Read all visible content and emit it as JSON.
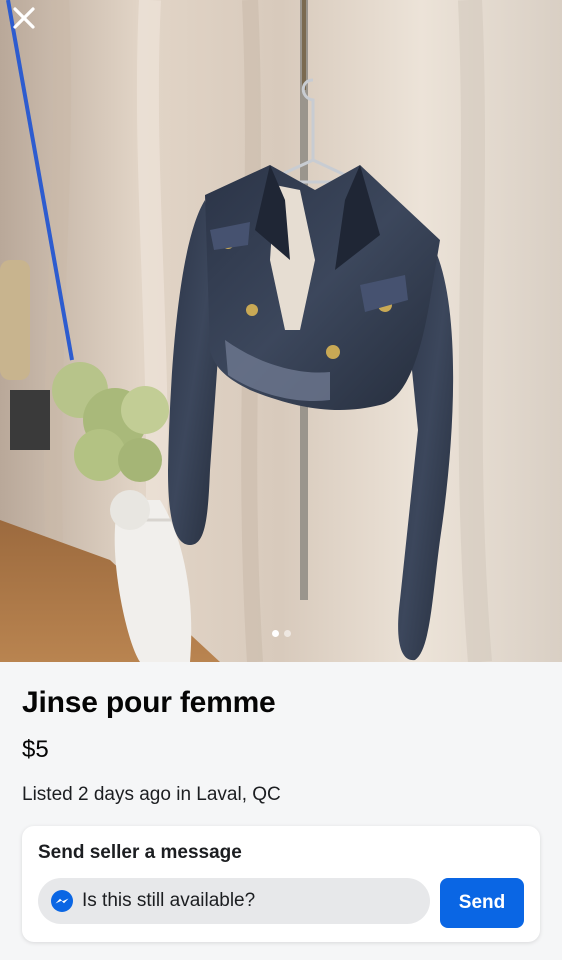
{
  "listing": {
    "title": "Jinse pour femme",
    "price": "$5",
    "listed_text": "Listed 2 days ago in Laval, QC",
    "photo_count": 2,
    "current_photo": 1
  },
  "message_card": {
    "heading": "Send seller a message",
    "input_value": "Is this still available?",
    "send_label": "Send"
  },
  "icons": {
    "close": "close-icon",
    "messenger": "messenger-icon"
  },
  "colors": {
    "accent": "#0a66e4",
    "background": "#f5f6f7"
  }
}
